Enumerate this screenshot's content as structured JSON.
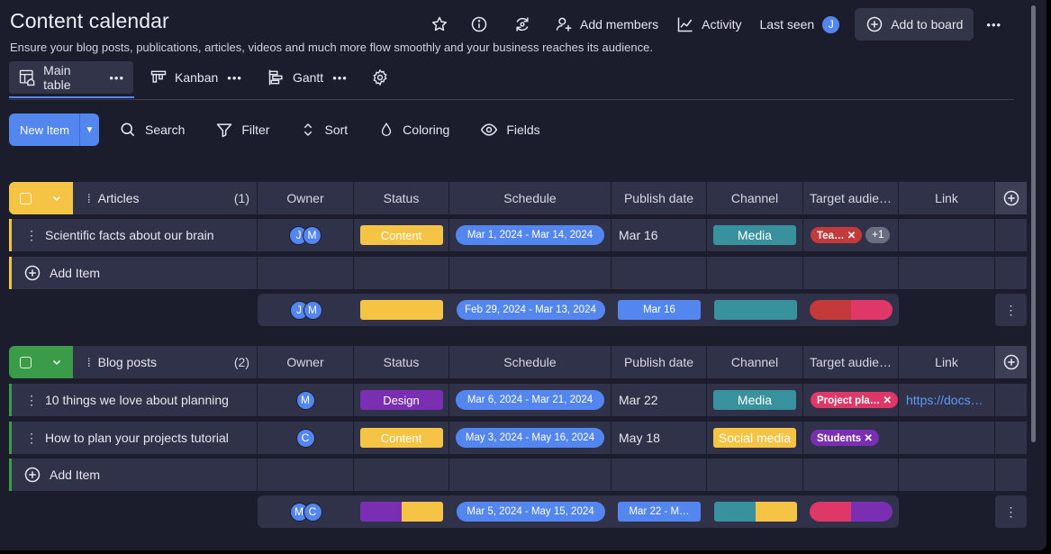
{
  "header": {
    "title": "Content calendar",
    "description": "Ensure your blog posts, publications, articles, videos and much more flow smoothly and your business reaches its audience.",
    "add_members": "Add members",
    "activity": "Activity",
    "last_seen": "Last seen",
    "last_seen_avatar": "J",
    "add_to_board": "Add to board",
    "more": "•••"
  },
  "views": [
    {
      "label": "Main table",
      "dots": "•••"
    },
    {
      "label": "Kanban",
      "dots": "•••"
    },
    {
      "label": "Gantt",
      "dots": "•••"
    }
  ],
  "toolbar": {
    "new_item": "New Item",
    "search": "Search",
    "filter": "Filter",
    "sort": "Sort",
    "coloring": "Coloring",
    "fields": "Fields"
  },
  "columns": {
    "owner": "Owner",
    "status": "Status",
    "schedule": "Schedule",
    "publish_date": "Publish date",
    "channel": "Channel",
    "target": "Target audie…",
    "link": "Link"
  },
  "add_item": "Add Item",
  "colors": {
    "yellow": "#f5c444",
    "green": "#3a9b49",
    "purple": "#7a2fb3",
    "blue": "#5486f0",
    "teal": "#38929d",
    "red": "#c4393a",
    "pink": "#df3768"
  },
  "groups": [
    {
      "name": "Articles",
      "count": "(1)",
      "color": "#f5c444",
      "items": [
        {
          "name": "Scientific facts about our brain",
          "owners": [
            "J",
            "M"
          ],
          "status": "Content",
          "status_color": "#f5c444",
          "schedule": "Mar 1, 2024 - Mar 14, 2024",
          "publish_date": "Mar 16",
          "channel": "Media",
          "channel_color": "#38929d",
          "tags": [
            {
              "label": "Tea… ✕",
              "color": "#c4393a"
            },
            {
              "label": "+1",
              "color": "#6b6e82"
            }
          ],
          "link": ""
        }
      ],
      "summary": {
        "owners": [
          "J",
          "M"
        ],
        "schedule": "Feb 29, 2024 - Mar 13, 2024",
        "publish_date": "Mar 16"
      }
    },
    {
      "name": "Blog posts",
      "count": "(2)",
      "color": "#3a9b49",
      "items": [
        {
          "name": "10 things we love about planning",
          "owners": [
            "M"
          ],
          "status": "Design",
          "status_color": "#7a2fb3",
          "schedule": "Mar 6, 2024 - Mar 21, 2024",
          "publish_date": "Mar 22",
          "channel": "Media",
          "channel_color": "#38929d",
          "tags": [
            {
              "label": "Project pla… ✕",
              "color": "#df3768"
            }
          ],
          "link": "https://docs…"
        },
        {
          "name": "How to plan your projects tutorial",
          "owners": [
            "C"
          ],
          "status": "Content",
          "status_color": "#f5c444",
          "schedule": "May 3, 2024 - May 16, 2024",
          "publish_date": "May 18",
          "channel": "Social media",
          "channel_color": "#f5c444",
          "tags": [
            {
              "label": "Students ✕",
              "color": "#7a2fb3"
            }
          ],
          "link": ""
        }
      ],
      "summary": {
        "owners": [
          "M",
          "C"
        ],
        "schedule": "Mar 5, 2024 - May 15, 2024",
        "publish_date": "Mar 22 - M…"
      }
    }
  ]
}
